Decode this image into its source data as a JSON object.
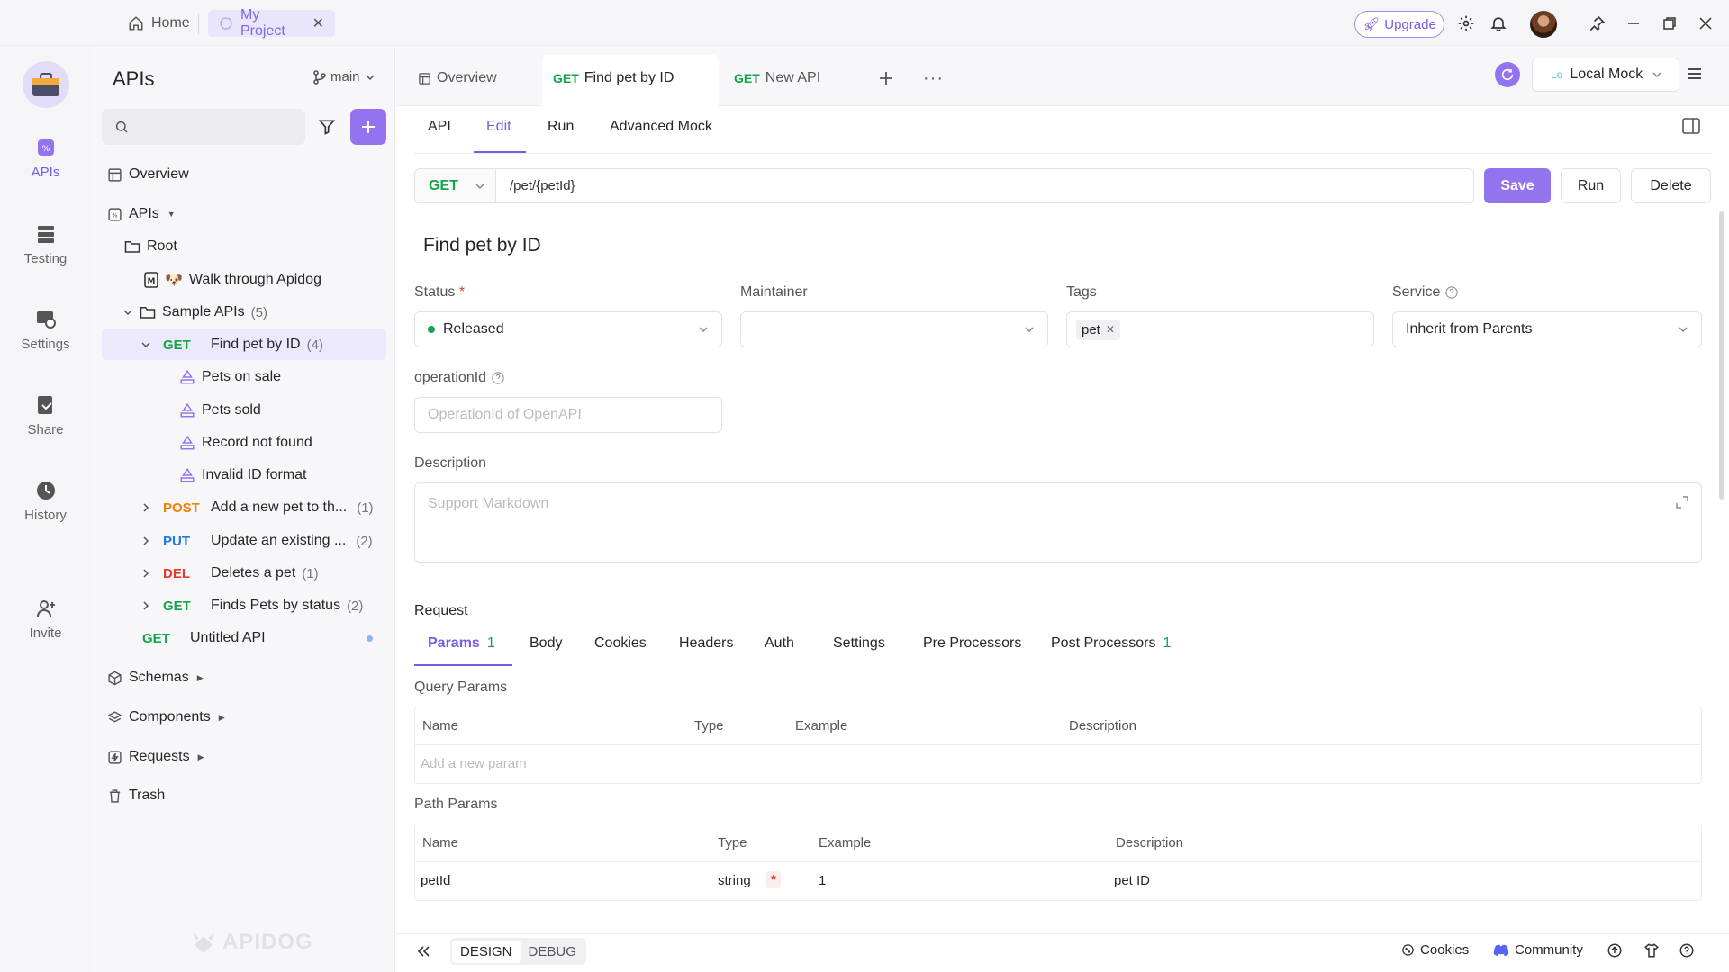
{
  "titlebar": {
    "home_label": "Home",
    "project_label": "My Project",
    "upgrade_label": "Upgrade"
  },
  "rail": {
    "items": [
      {
        "label": "APIs",
        "icon": "api-icon",
        "active": true
      },
      {
        "label": "Testing",
        "icon": "testing-icon"
      },
      {
        "label": "Settings",
        "icon": "settings-icon"
      },
      {
        "label": "Share",
        "icon": "share-icon"
      },
      {
        "label": "History",
        "icon": "history-icon"
      },
      {
        "label": "Invite",
        "icon": "invite-icon"
      }
    ]
  },
  "sidebar": {
    "title": "APIs",
    "branch": "main",
    "overview": "Overview",
    "apis": "APIs",
    "root": "Root",
    "walkthrough": "Walk through Apidog",
    "sample_apis": "Sample APIs",
    "sample_count": "(5)",
    "find_pet": {
      "method": "GET",
      "name": "Find pet by ID",
      "count": "(4)"
    },
    "cases": [
      "Pets on sale",
      "Pets sold",
      "Record not found",
      "Invalid ID format"
    ],
    "endpoints": [
      {
        "method": "POST",
        "name": "Add a new pet to th...",
        "count": "(1)"
      },
      {
        "method": "PUT",
        "name": "Update an existing ...",
        "count": "(2)"
      },
      {
        "method": "DEL",
        "name": "Deletes a pet",
        "count": "(1)"
      },
      {
        "method": "GET",
        "name": "Finds Pets by status",
        "count": "(2)"
      }
    ],
    "untitled": {
      "method": "GET",
      "name": "Untitled API"
    },
    "schemas": "Schemas",
    "components": "Components",
    "requests": "Requests",
    "trash": "Trash",
    "watermark": "APIDOG"
  },
  "tabs": {
    "overview": "Overview",
    "active": {
      "method": "GET",
      "name": "Find pet by ID"
    },
    "new": {
      "method": "GET",
      "name": "New API"
    },
    "env": "Local Mock",
    "env_short": "Lo"
  },
  "subtabs": [
    "API",
    "Edit",
    "Run",
    "Advanced Mock"
  ],
  "url": {
    "method": "GET",
    "path": "/pet/{petId}",
    "save": "Save",
    "run": "Run",
    "delete": "Delete"
  },
  "form": {
    "api_name": "Find pet by ID",
    "status_label": "Status",
    "status_value": "Released",
    "maintainer_label": "Maintainer",
    "tags_label": "Tags",
    "tag": "pet",
    "service_label": "Service",
    "service_value": "Inherit from Parents",
    "opid_label": "operationId",
    "opid_placeholder": "OperationId of OpenAPI",
    "desc_label": "Description",
    "desc_placeholder": "Support Markdown"
  },
  "request": {
    "title": "Request",
    "tabs": [
      {
        "label": "Params",
        "badge": "1"
      },
      {
        "label": "Body"
      },
      {
        "label": "Cookies"
      },
      {
        "label": "Headers"
      },
      {
        "label": "Auth"
      },
      {
        "label": "Settings"
      },
      {
        "label": "Pre Processors"
      },
      {
        "label": "Post Processors",
        "badge": "1"
      }
    ],
    "query_title": "Query Params",
    "columns": [
      "Name",
      "Type",
      "Example",
      "Description"
    ],
    "add_param": "Add a new param",
    "path_title": "Path Params",
    "path_row": {
      "name": "petId",
      "type": "string",
      "required": "*",
      "example": "1",
      "description": "pet ID"
    }
  },
  "bottom": {
    "design": "DESIGN",
    "debug": "DEBUG",
    "cookies": "Cookies",
    "community": "Community"
  },
  "colors": {
    "accent": "#9474ee",
    "get": "#17a34a",
    "post": "#f08000",
    "put": "#1d78e6",
    "delete": "#e23d28"
  }
}
